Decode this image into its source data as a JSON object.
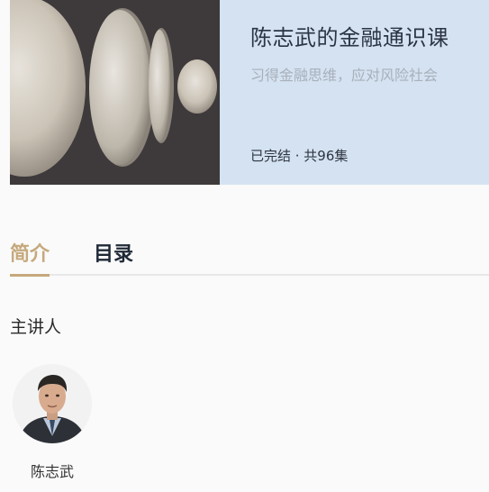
{
  "course": {
    "title": "陈志武的金融通识课",
    "subtitle": "习得金融思维，应对风险社会",
    "status": "已完结 · 共96集"
  },
  "tabs": [
    {
      "label": "简介",
      "active": true
    },
    {
      "label": "目录",
      "active": false
    }
  ],
  "lecturer_section": {
    "title": "主讲人",
    "lecturers": [
      {
        "name": "陈志武"
      }
    ]
  },
  "colors": {
    "accent": "#c5a97c",
    "info_bg": "#d4e2f1",
    "cover_bg": "#3e3a3b"
  }
}
